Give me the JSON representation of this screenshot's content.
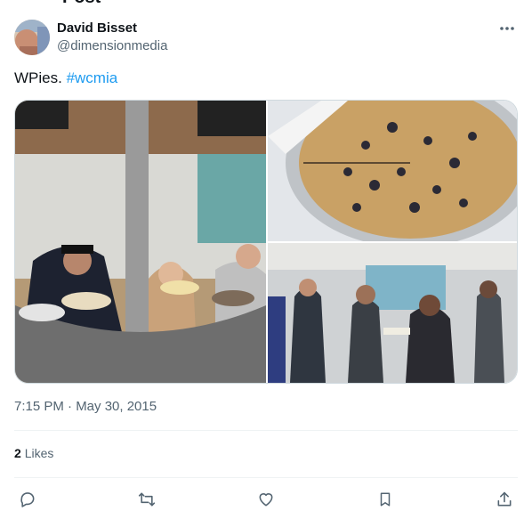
{
  "page_header_fragment": "Post",
  "author": {
    "name": "David Bisset",
    "handle": "@dimensionmedia"
  },
  "tweet": {
    "text": "WPies.",
    "hashtag": "#wcmia"
  },
  "media": [
    {
      "description": "people serving pies at a counter"
    },
    {
      "description": "blueberry pie in tin"
    },
    {
      "description": "crowd in hall holding plates"
    }
  ],
  "timestamp": "7:15 PM · May 30, 2015",
  "stats": {
    "likes_count": "2",
    "likes_label": "Likes"
  },
  "icons": {
    "more": "more-icon",
    "reply": "reply-icon",
    "retweet": "retweet-icon",
    "like": "heart-icon",
    "bookmark": "bookmark-icon",
    "share": "share-icon"
  },
  "colors": {
    "link": "#1d9bf0",
    "secondary_text": "#536471",
    "text": "#0f1419",
    "divider": "#eff3f4"
  }
}
